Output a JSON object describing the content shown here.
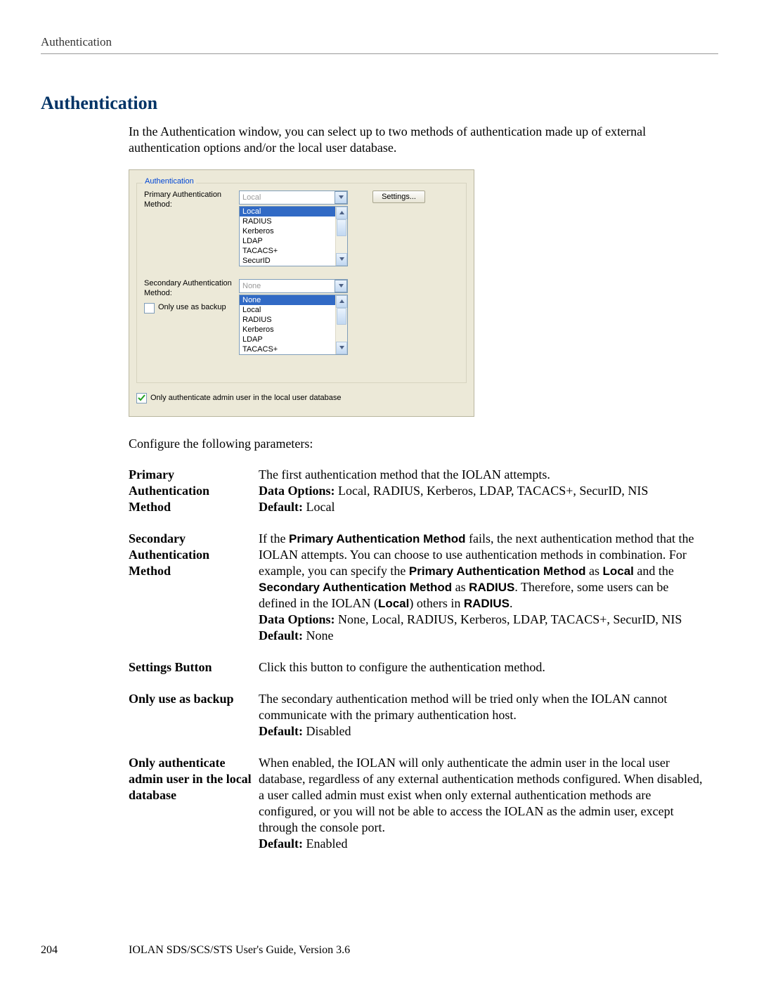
{
  "running_head": "Authentication",
  "title": "Authentication",
  "intro": "In the Authentication window, you can select up to two methods of authentication made up of external authentication options and/or the local user database.",
  "dialog": {
    "group_label": "Authentication",
    "primary_label": "Primary Authentication Method:",
    "primary_selected": "Local",
    "primary_options": [
      "Local",
      "RADIUS",
      "Kerberos",
      "LDAP",
      "TACACS+",
      "SecurID"
    ],
    "settings_btn": "Settings...",
    "secondary_label": "Secondary Authentication Method:",
    "secondary_selected": "None",
    "secondary_options": [
      "None",
      "Local",
      "RADIUS",
      "Kerberos",
      "LDAP",
      "TACACS+"
    ],
    "only_backup_label": "Only use as backup",
    "only_backup_checked": false,
    "admin_only_label": "Only authenticate admin user in the local user database",
    "admin_only_checked": true
  },
  "config_lead": "Configure the following parameters:",
  "params": {
    "primary": {
      "key": "Primary Authentication Method",
      "desc": "The first authentication method that the IOLAN attempts.",
      "data_opts_label": "Data Options:",
      "data_opts": " Local, RADIUS, Kerberos, LDAP, TACACS+, SecurID, NIS",
      "default_label": "Default:",
      "default_val": " Local"
    },
    "secondary": {
      "key": "Secondary Authentication Method",
      "desc_pre": "If the ",
      "desc_b1": "Primary Authentication Method",
      "desc_mid1": " fails, the next authentication method that the IOLAN attempts. You can choose to use authentication methods in combination. For example, you can specify the ",
      "desc_b2": "Primary Authentication Method",
      "desc_mid2": " as ",
      "desc_b3": "Local",
      "desc_mid3": " and the ",
      "desc_b4": "Secondary Authentication Method",
      "desc_mid4": " as ",
      "desc_b5": "RADIUS",
      "desc_mid5": ". Therefore, some users can be defined in the IOLAN (",
      "desc_b6": "Local",
      "desc_mid6": ") others in ",
      "desc_b7": "RADIUS",
      "desc_post": ".",
      "data_opts_label": "Data Options:",
      "data_opts": " None, Local, RADIUS, Kerberos, LDAP, TACACS+, SecurID, NIS",
      "default_label": "Default:",
      "default_val": " None"
    },
    "settings": {
      "key": "Settings Button",
      "desc": "Click this button to configure the authentication method."
    },
    "backup": {
      "key": "Only use as backup",
      "desc": "The secondary authentication method will be tried only when the IOLAN cannot communicate with the primary authentication host.",
      "default_label": "Default:",
      "default_val": " Disabled"
    },
    "admin": {
      "key": "Only authenticate admin user in the local database",
      "desc": "When enabled, the IOLAN will only authenticate the admin user in the local user database, regardless of any external authentication methods configured. When disabled, a user called admin must exist when only external authentication methods are configured, or you will not be able to access the IOLAN as the admin user, except through the console port.",
      "default_label": "Default:",
      "default_val": " Enabled"
    }
  },
  "footer": {
    "page": "204",
    "text": "IOLAN SDS/SCS/STS User's Guide, Version 3.6"
  }
}
